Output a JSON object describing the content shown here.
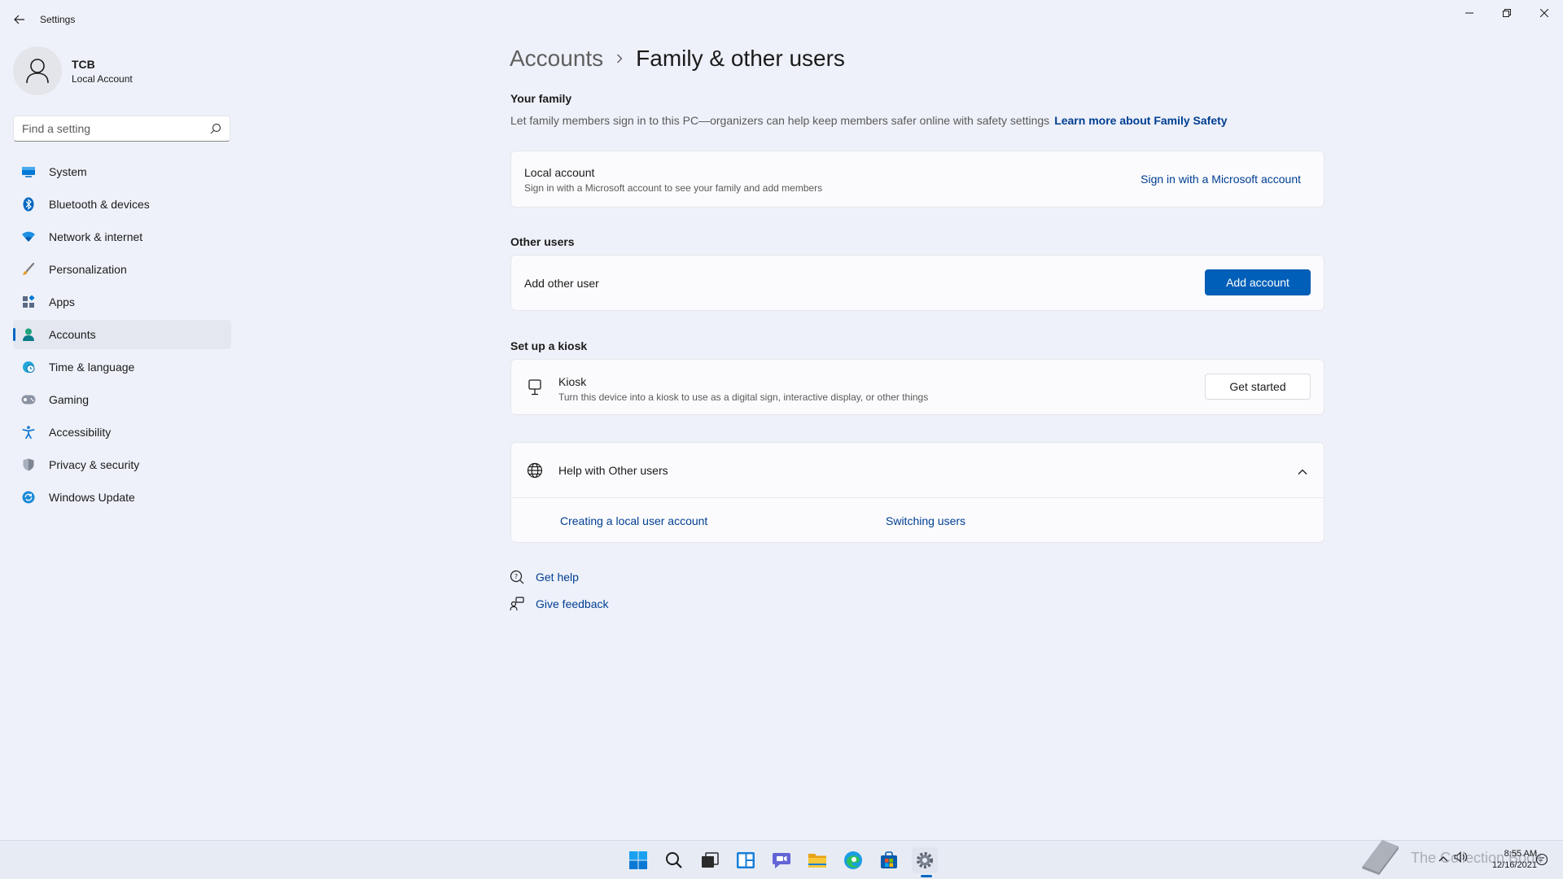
{
  "window": {
    "title": "Settings"
  },
  "profile": {
    "name": "TCB",
    "account_type": "Local Account"
  },
  "search": {
    "placeholder": "Find a setting"
  },
  "sidebar": {
    "items": [
      {
        "label": "System",
        "icon": "monitor-icon",
        "active": false
      },
      {
        "label": "Bluetooth & devices",
        "icon": "bluetooth-icon",
        "active": false
      },
      {
        "label": "Network & internet",
        "icon": "wifi-icon",
        "active": false
      },
      {
        "label": "Personalization",
        "icon": "brush-icon",
        "active": false
      },
      {
        "label": "Apps",
        "icon": "apps-icon",
        "active": false
      },
      {
        "label": "Accounts",
        "icon": "person-icon",
        "active": true
      },
      {
        "label": "Time & language",
        "icon": "globe-clock-icon",
        "active": false
      },
      {
        "label": "Gaming",
        "icon": "gamepad-icon",
        "active": false
      },
      {
        "label": "Accessibility",
        "icon": "accessibility-icon",
        "active": false
      },
      {
        "label": "Privacy & security",
        "icon": "shield-icon",
        "active": false
      },
      {
        "label": "Windows Update",
        "icon": "update-icon",
        "active": false
      }
    ]
  },
  "breadcrumb": {
    "parent": "Accounts",
    "current": "Family & other users"
  },
  "family": {
    "title": "Your family",
    "description": "Let family members sign in to this PC—organizers can help keep members safer online with safety settings",
    "learn_more": "Learn more about Family Safety",
    "card": {
      "title": "Local account",
      "subtitle": "Sign in with a Microsoft account to see your family and add members",
      "action": "Sign in with a Microsoft account"
    }
  },
  "other_users": {
    "title": "Other users",
    "card": {
      "title": "Add other user",
      "action": "Add account"
    }
  },
  "kiosk": {
    "title": "Set up a kiosk",
    "card": {
      "title": "Kiosk",
      "subtitle": "Turn this device into a kiosk to use as a digital sign, interactive display, or other things",
      "action": "Get started"
    }
  },
  "help": {
    "title": "Help with Other users",
    "links": [
      "Creating a local user account",
      "Switching users"
    ]
  },
  "footer": {
    "get_help": "Get help",
    "give_feedback": "Give feedback"
  },
  "taskbar": {
    "apps": [
      "start-icon",
      "search-icon",
      "task-view-icon",
      "widgets-icon",
      "chat-icon",
      "file-explorer-icon",
      "edge-icon",
      "store-icon",
      "settings-icon"
    ],
    "watermark": "The Collection Book",
    "time": "8:55 AM",
    "date": "12/16/2021"
  },
  "colors": {
    "accent": "#005fb8",
    "link": "#003e92",
    "background": "#eef1f9",
    "card": "#fbfbfd"
  }
}
